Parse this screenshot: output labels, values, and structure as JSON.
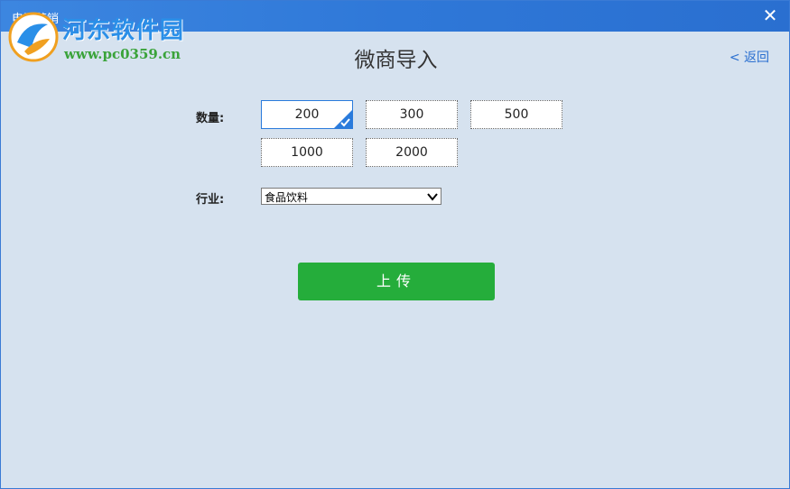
{
  "window": {
    "title": "电话营销",
    "close_glyph": "✕"
  },
  "watermark": {
    "site_name": "河东软件园",
    "url": "www.pc0359.cn"
  },
  "header": {
    "page_title": "微商导入",
    "back_label": "< 返回"
  },
  "form": {
    "quantity_label": "数量:",
    "quantity_options": [
      "200",
      "300",
      "500",
      "1000",
      "2000"
    ],
    "selected_quantity": "200",
    "industry_label": "行业:",
    "industry_value": "食品饮料"
  },
  "actions": {
    "upload_label": "上传"
  },
  "colors": {
    "titlebar": "#2f78d8",
    "background": "#d6e2ef",
    "accent": "#2a7bdc",
    "upload_button": "#25ad3b",
    "link": "#2a6fd0"
  },
  "icons": {
    "close": "close-icon",
    "check": "check-corner-icon",
    "dropdown": "chevron-down-icon",
    "logo": "logo-icon"
  }
}
